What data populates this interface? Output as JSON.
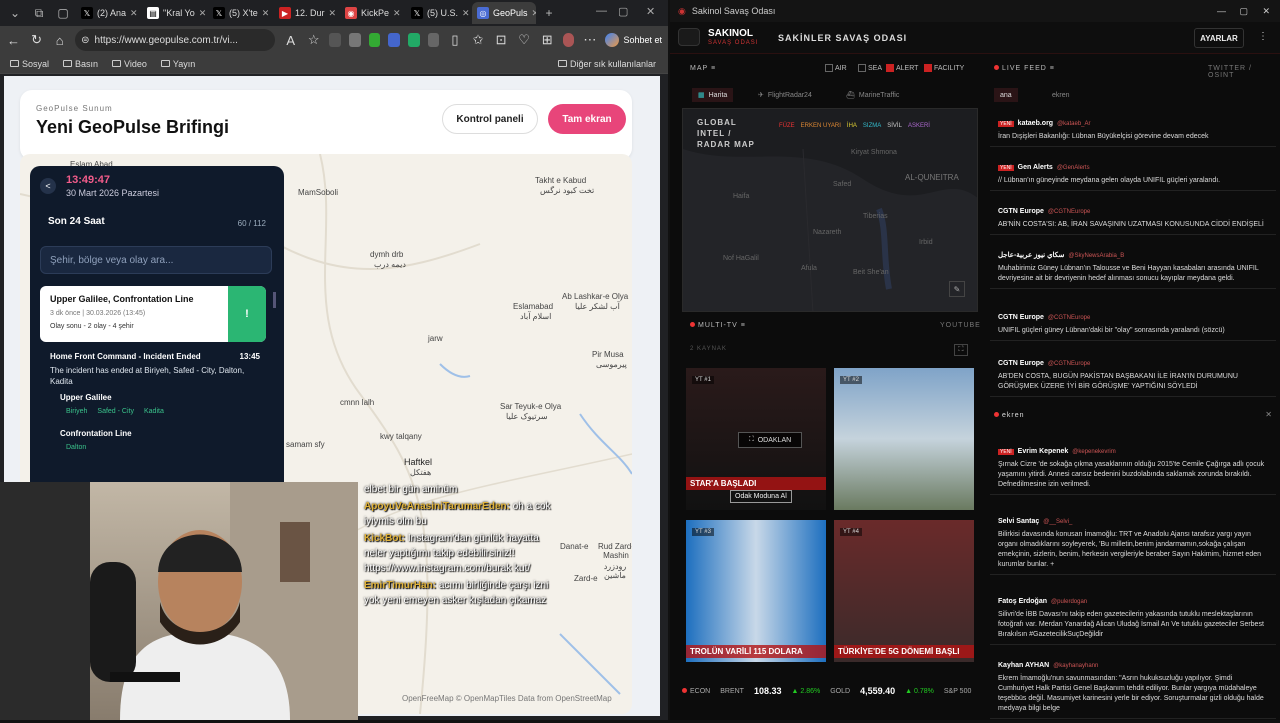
{
  "browser": {
    "tabs": [
      {
        "label": "(2) Ana"
      },
      {
        "label": "\"Kral Yo"
      },
      {
        "label": "(5) X'te"
      },
      {
        "label": "12. Dur"
      },
      {
        "label": "KickPe"
      },
      {
        "label": "(5) U.S."
      },
      {
        "label": "GeoPuls"
      }
    ],
    "url": "https://www.geopulse.com.tr/vi...",
    "copilot": "Sohbet et",
    "bookmarks": [
      "Sosyal",
      "Basın",
      "Video",
      "Yayın"
    ],
    "bookmarks_other": "Diğer sık kullanılanlar"
  },
  "page": {
    "subtitle": "GeoPulse Sunum",
    "title": "Yeni GeoPulse Brifingi",
    "btn_panel": "Kontrol paneli",
    "btn_full": "Tam ekran",
    "map_credit": "OpenFreeMap © OpenMapTiles Data from OpenStreetMap"
  },
  "map_labels": [
    "Eslam Abad",
    "Takht e Kabud",
    "تخت کبود نرگس",
    "MamSoboli",
    "dymh drb",
    "دیمه درب",
    "Eslamabad",
    "اسلام آباد",
    "Ab Lashkar-e Olya",
    "آب لشکر علیا",
    "jarw",
    "Pir Musa",
    "پیرموسی",
    "Sar Teyuk-e Olya",
    "سرتیوک علیا",
    "cmnn lalh",
    "Haftkel",
    "هفتکل",
    "kwy talqany",
    "samam sfy",
    "Danat-e",
    "Rud Zard-Mashin",
    "رودزرد ماشین",
    "Zard-e"
  ],
  "panel": {
    "clock": "13:49:47",
    "date": "30 Mart 2026 Pazartesi",
    "last24": "Son 24 Saat",
    "count": "60 / 112",
    "search_placeholder": "Şehir, bölge veya olay ara...",
    "card1": {
      "title": "Upper Galilee, Confrontation Line",
      "meta": "3 dk önce | 30.03.2026 (13:45)",
      "sub": "Olay sonu - 2 olay - 4 şehir",
      "badge": "!"
    },
    "ev2": {
      "title": "Home Front Command - Incident Ended",
      "time": "13:45",
      "text": "The incident has ended at Biriyeh, Safed - City, Dalton, Kadita",
      "h1": "Upper Galilee",
      "tags1": [
        "Biriyeh",
        "Safed - City",
        "Kadita"
      ],
      "h2": "Confrontation Line",
      "tags2": [
        "Dalton"
      ]
    }
  },
  "chat": [
    {
      "user": "",
      "msg": "elbet bir gün aminüm"
    },
    {
      "user": "ApoyuVeAnasiniTarumarEden:",
      "msg": "oh a cok iyiymis olm bu"
    },
    {
      "user": "KickBot:",
      "msg": "Instagram'dan günlük hayatta neler yaptığımı takip edebilirsiniz!! https://www.instagram.com/burak kut/"
    },
    {
      "user": "EmirTimurHan:",
      "msg": "acımı birliğinde çarşı izni yok yeni emeyen asker kışladan çıkamaz"
    }
  ],
  "app": {
    "window_title": "Sakinol Savaş Odası",
    "brand": "SAKINOL",
    "brand_sub": "SAVAŞ ODASI",
    "room": "SAKİNLER SAVAŞ ODASI",
    "settings": "AYARLAR",
    "map_lbl": "MAP ≡",
    "filters": [
      {
        "label": "AIR",
        "on": false
      },
      {
        "label": "SEA",
        "on": false
      },
      {
        "label": "ALERT",
        "on": true
      },
      {
        "label": "FACILITY",
        "on": true
      }
    ],
    "map_tabs": [
      "Harita",
      "FlightRadar24",
      "MarineTraffic"
    ],
    "radar_title": "GLOBAL INTEL / RADAR MAP",
    "legend": [
      "FÜZE",
      "ERKEN UYARI",
      "İHA",
      "SIZMA",
      "SİVİL",
      "ASKERİ"
    ],
    "radar_places": [
      "AL-QUNEITRA",
      "Kiryat Shmona",
      "Safed",
      "Nazareth",
      "Tiberias",
      "Haifa",
      "Afula",
      "Nof HaGalil",
      "Beit She'an",
      "Irbid"
    ],
    "multitv": "MULTI-TV ≡",
    "youtube": "YOUTUBE",
    "sources": "2 KAYNAK",
    "tv": [
      {
        "lbl": "YT #1",
        "cap": "STAR'A BAŞLADI"
      },
      {
        "lbl": "YT #2",
        "cap": ""
      },
      {
        "lbl": "YT #3",
        "cap": "TROLÜN VARİLİ 115 DOLARA"
      },
      {
        "lbl": "YT #4",
        "cap": "TÜRKİYE'DE 5G DÖNEMİ BAŞLI"
      }
    ],
    "focus_btn": "ODAKLAN",
    "focus_tip": "Odak Moduna Al",
    "econ": {
      "label": "ECON",
      "brent_l": "BRENT",
      "brent": "108.33",
      "brent_c": "▲ 2.86%",
      "gold_l": "GOLD",
      "gold": "4,559.40",
      "gold_c": "▲ 0.78%",
      "sp_l": "S&P 500"
    },
    "live": "LIVE FEED ≡",
    "live_src": "TWITTER / OSINT",
    "feed_tabs": [
      "ana",
      "ekren"
    ],
    "feed": [
      {
        "src": "kataeb.org",
        "hnd": "@kataeb_Ar",
        "yeni": true,
        "tx": "İran Dışişleri Bakanlığı: Lübnan Büyükelçisi görevine devam edecek"
      },
      {
        "src": "Gen Alerts",
        "hnd": "@GenAlerts",
        "yeni": true,
        "tx": "// Lübnan'ın güneyinde meydana gelen olayda UNIFIL güçleri yaralandı."
      },
      {
        "src": "CGTN Europe",
        "hnd": "@CGTNEurope",
        "yeni": false,
        "tx": "AB'NİN COSTA'SI: AB, İRAN SAVAŞININ UZATMASI KONUSUNDA CİDDİ ENDİŞELİ"
      },
      {
        "src": "سكاي نيوز عربية-عاجل",
        "hnd": "@SkyNewsArabia_B",
        "yeni": false,
        "tx": "Muhabirimiz Güney Lübnan'ın Talousse ve Beni Hayyan kasabaları arasında UNIFIL devriyesine ait bir devriyenin hedef alınması sonucu kayıplar meydana geldi."
      },
      {
        "src": "CGTN Europe",
        "hnd": "@CGTNEurope",
        "yeni": false,
        "tx": "UNIFIL güçleri güney Lübnan'daki bir \"olay\" sonrasında yaralandı (sözcü)"
      },
      {
        "src": "CGTN Europe",
        "hnd": "@CGTNEurope",
        "yeni": false,
        "tx": "AB'DEN COSTA, BUGÜN PAKİSTAN BAŞBAKANI İLE İRAN'IN DURUMUNU GÖRÜŞMEK ÜZERE 'İYİ BİR GÖRÜŞME' YAPTIĞINI SÖYLEDİ"
      }
    ],
    "feed2_title": "ekren",
    "feed2": [
      {
        "src": "Evrim Kepenek",
        "hnd": "@kepenekevrim",
        "yeni": true,
        "tx": "Şırnak Cizre 'de sokağa çıkma yasaklarının olduğu 2015'te Cemile Çağırga adlı çocuk yaşamını yitirdi. Annesi cansız bedenini buzdolabında saklamak zorunda bırakıldı. Defnedilmesine izin verilmedi."
      },
      {
        "src": "Selvi Santaç",
        "hnd": "@__Selvi_",
        "yeni": false,
        "tx": "Bilirkisi davasında konusan İmamoğlu: TRT ve Anadolu Ajansı tarafsız yargı yayın organı olmadıklarını soyleyerek, 'Bu milletin,benim jandarmamın,sokağa çalışan emekçinin, sizlerin, benim, herkesin vergileriyle beraber Sayın Hakimim, hizmet eden kurumlar bunlar. +"
      },
      {
        "src": "Fatoş Erdoğan",
        "hnd": "@pulerdogan",
        "yeni": false,
        "tx": "Silivri'de İBB Davası'nı takip eden gazetecilerin yakasında tutuklu meslektaşlarının fotoğrafı var. Merdan Yanardağ Alican Uludağ İsmail An Ve tutuklu gazeteciler Serbest Bırakılsın #GazetecilikSuçDeğildir"
      },
      {
        "src": "Kayhan AYHAN",
        "hnd": "@kayhanayhann",
        "yeni": false,
        "tx": "Ekrem İmamoğlu'nun savunmasından: \"Asrın hukuksuzluğu yapılıyor. Şimdi Cumhuriyet Halk Partisi Genel Başkanım tehdit ediliyor. Bunlar yargıya müdahaleye teşebbüs değil. Masumiyet karinesini yerle bir ediyor. Soruşturmalar gizli olduğu halde medyaya bilgi belge"
      }
    ]
  },
  "colors": {
    "accent": "#e8457a",
    "app_red": "#cc2222",
    "panel": "#0f1a2b",
    "tag_green": "#3ac28b"
  }
}
